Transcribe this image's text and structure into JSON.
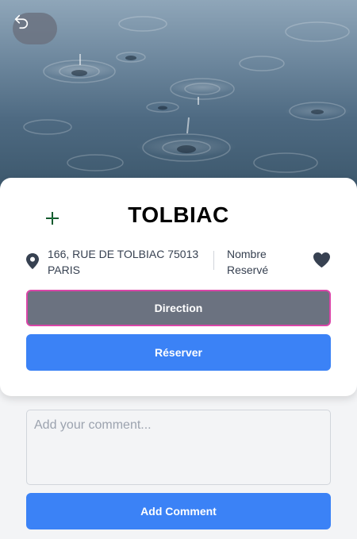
{
  "header": {
    "hero_image": "rain-drops-on-water-photo",
    "back_icon": "back-arrow-icon"
  },
  "place": {
    "title": "TOLBIAC",
    "address_line1": "166, RUE DE TOLBIAC 75013",
    "address_line2": "PARIS",
    "count_label_line1": "Nombre",
    "count_label_line2": "Reservé",
    "add_icon": "plus-icon",
    "location_icon": "map-pin-icon",
    "favorite_icon": "heart-icon"
  },
  "actions": {
    "direction_label": "Direction",
    "reserve_label": "Réserver"
  },
  "comments": {
    "placeholder": "Add your comment...",
    "value": "",
    "submit_label": "Add Comment"
  },
  "colors": {
    "primary": "#3b82f6",
    "secondary": "#6b7280",
    "focus_outline": "#d946a8",
    "plus_icon": "#16a34a"
  }
}
